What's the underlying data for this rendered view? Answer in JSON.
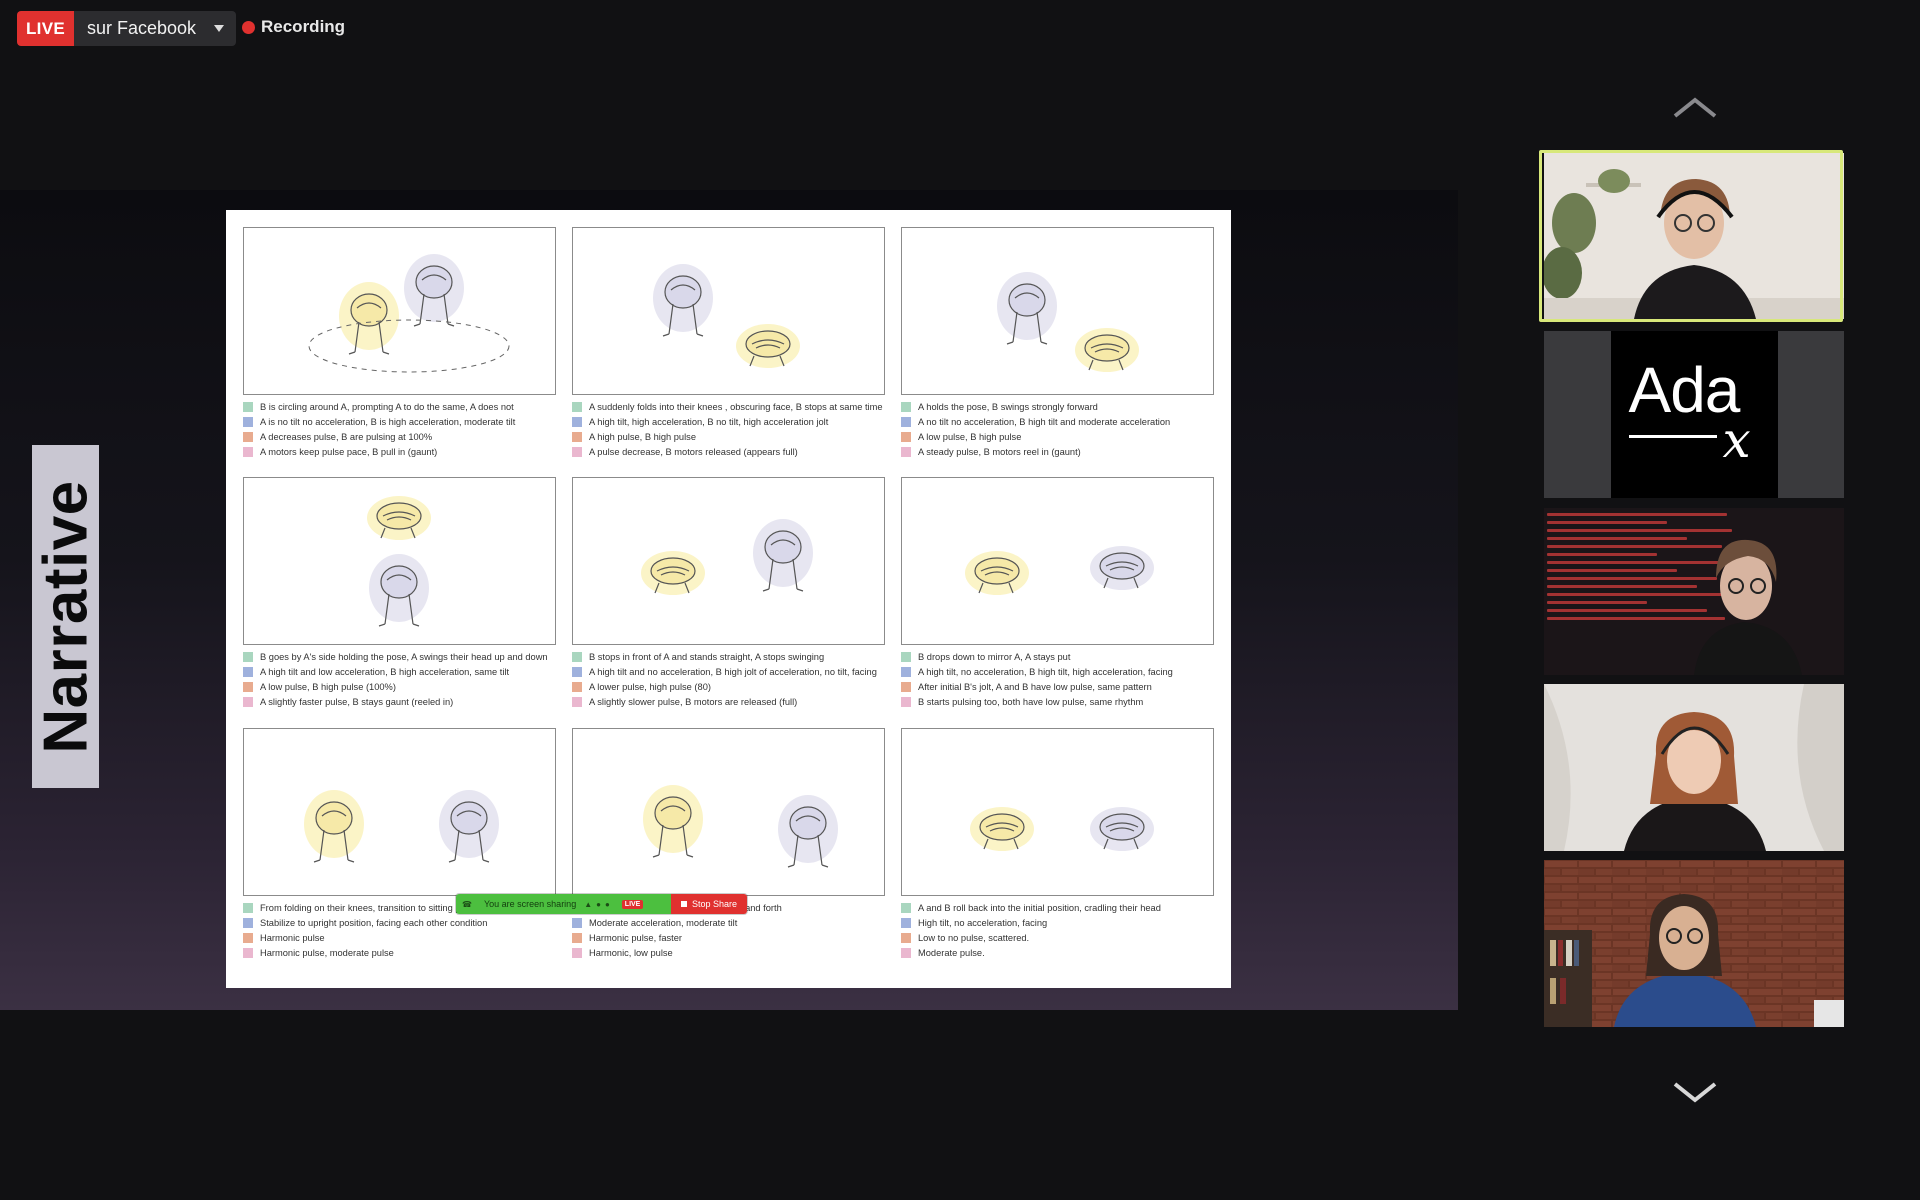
{
  "live_stream": {
    "badge": "LIVE",
    "destination": "sur Facebook"
  },
  "recording": {
    "label": "Recording"
  },
  "slide_tab": {
    "label": "Narrative"
  },
  "legend_colors": [
    "#a9d6bf",
    "#9fb1dd",
    "#e8ab8f",
    "#eab7cf"
  ],
  "panels": [
    {
      "lines": [
        "B is circling around A, prompting A to do the same, A does not",
        "A is no tilt no acceleration, B is high acceleration, moderate tilt",
        "A decreases pulse, B are pulsing at 100%",
        "A motors keep pulse pace, B pull in (gaunt)"
      ]
    },
    {
      "lines": [
        "A suddenly folds into their knees , obscuring face, B stops at same time",
        "A high tilt, high acceleration, B no tilt, high acceleration jolt",
        "A high pulse, B high pulse",
        "A pulse decrease, B motors released (appears full)"
      ]
    },
    {
      "lines": [
        "A holds the pose, B swings strongly forward",
        "A no tilt no acceleration, B high tilt and moderate acceleration",
        "A low pulse, B high pulse",
        "A steady pulse, B motors reel in (gaunt)"
      ]
    },
    {
      "lines": [
        "B goes by A's side holding the pose, A swings their head up and down",
        "A high tilt and low acceleration, B high acceleration, same tilt",
        "A low pulse, B high pulse (100%)",
        "A slightly faster pulse, B stays gaunt (reeled in)"
      ]
    },
    {
      "lines": [
        "B stops in front of A and stands straight, A stops swinging",
        "A high tilt and no acceleration, B high jolt of acceleration, no tilt, facing",
        "A lower pulse, high pulse (80)",
        "A slightly slower pulse, B motors are released (full)"
      ]
    },
    {
      "lines": [
        "B drops down to mirror A, A stays put",
        "A high tilt, no acceleration, B high tilt, high acceleration, facing",
        "After initial B's jolt, A and B have low pulse, same pattern",
        "B starts pulsing too, both have low pulse, same rhythm"
      ]
    },
    {
      "lines": [
        "From folding on their knees, transition to sitting position, still facing",
        "Stabilize to upright position, facing each other condition",
        "Harmonic pulse",
        "Harmonic pulse, moderate pulse"
      ]
    },
    {
      "lines": [
        "A and B alternate gently rocking back and forth",
        "Moderate acceleration, moderate tilt",
        "Harmonic pulse, faster",
        "Harmonic, low pulse"
      ]
    },
    {
      "lines": [
        "A and B roll back into the initial position, cradling their head",
        "High tilt, no acceleration, facing",
        "Low to no pulse, scattered.",
        "Moderate pulse."
      ]
    }
  ],
  "screen_share_bar": {
    "message": "You are screen sharing",
    "live_badge": "LIVE",
    "stop_label": "Stop Share"
  },
  "participants": [
    {
      "name": "participant-1",
      "speaking": true
    },
    {
      "name": "ada-x",
      "logo_text": "Ada",
      "logo_sub": "x"
    },
    {
      "name": "participant-3"
    },
    {
      "name": "participant-4"
    },
    {
      "name": "participant-5"
    }
  ],
  "colors": {
    "live_red": "#e0312f",
    "speaker_highlight": "#d8e87a",
    "screen_share_green": "#4cbf3f"
  }
}
